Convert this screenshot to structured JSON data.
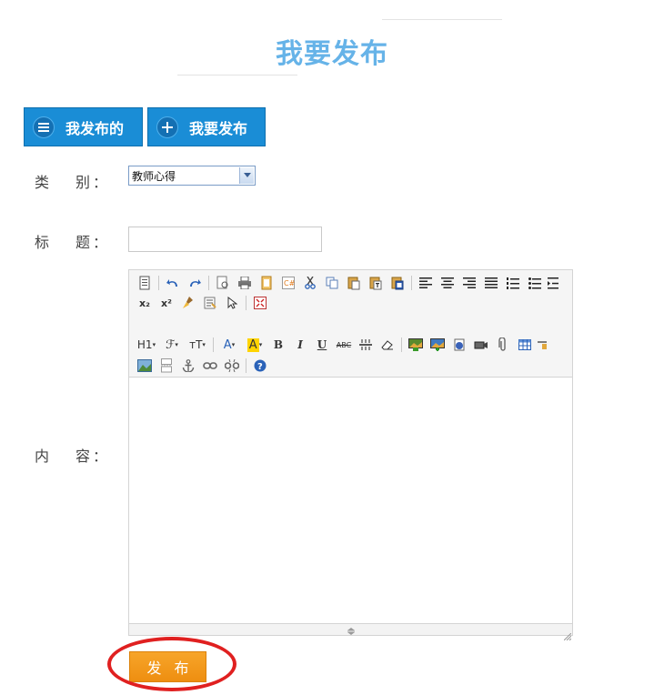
{
  "header": {
    "title": "我要发布"
  },
  "nav": {
    "my_posts_label": "我发布的",
    "new_post_label": "我要发布"
  },
  "form": {
    "category_label": [
      "类",
      "别："
    ],
    "category_value": "教师心得",
    "title_label": [
      "标",
      "题："
    ],
    "title_value": "",
    "content_label": [
      "内",
      "容："
    ]
  },
  "toolbar": {
    "heading_label": "H1",
    "font_family_label": "ℱ",
    "font_size_label": "тT",
    "font_color_label": "A",
    "highlight_label": "A",
    "bold_label": "B",
    "italic_label": "I",
    "underline_label": "U",
    "strike_label": "ABC",
    "subscript_label": "x₂",
    "superscript_label": "x²",
    "html_label": "C#"
  },
  "submit": {
    "label": "发布"
  },
  "colors": {
    "accent_blue": "#1a8dd6",
    "title_blue": "#66b3e8",
    "submit_orange": "#f39a1e",
    "annotation_red": "#e02020"
  }
}
